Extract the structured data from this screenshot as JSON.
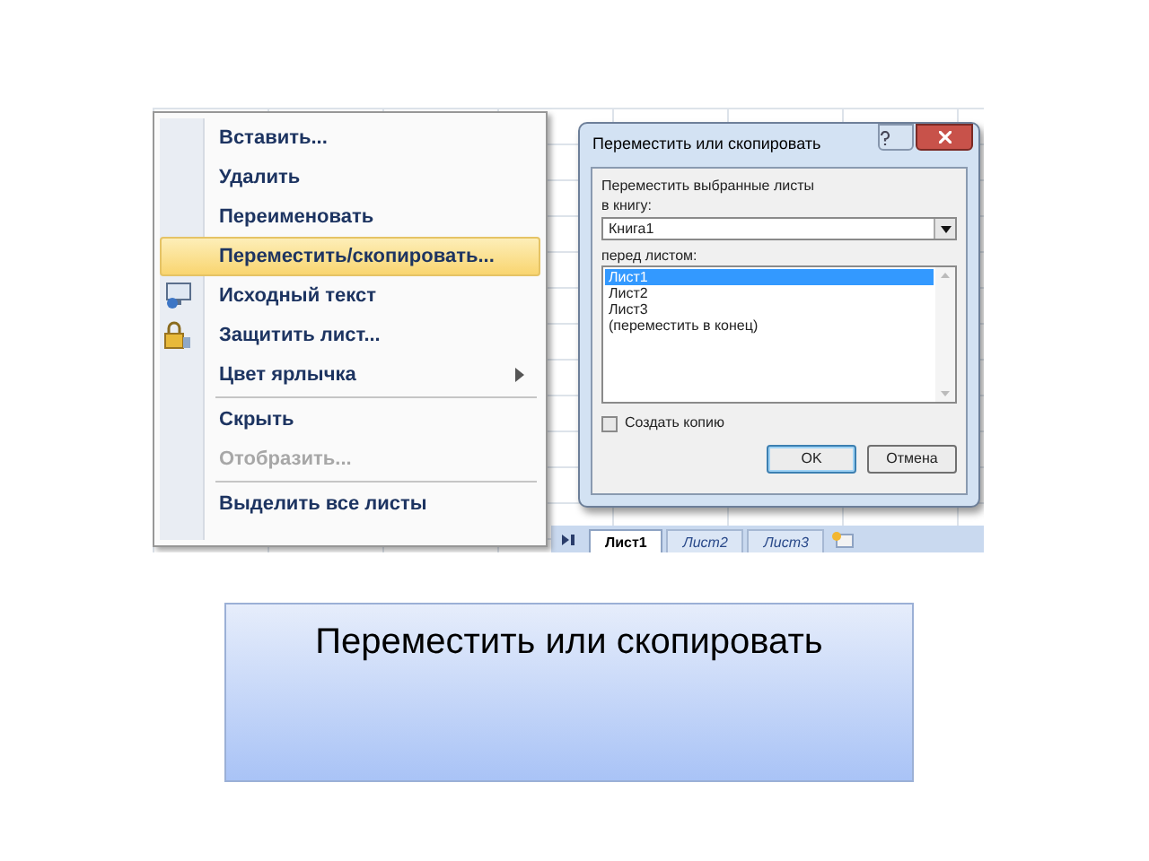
{
  "context_menu": {
    "items": [
      {
        "label": "Вставить...",
        "kind": "normal",
        "separator_before": false
      },
      {
        "label": "Удалить",
        "kind": "normal",
        "separator_before": false
      },
      {
        "label": "Переименовать",
        "kind": "normal",
        "separator_before": false
      },
      {
        "label": "Переместить/скопировать...",
        "kind": "highlighted",
        "separator_before": false
      },
      {
        "label": "Исходный текст",
        "kind": "source",
        "separator_before": false
      },
      {
        "label": "Защитить лист...",
        "kind": "protect",
        "separator_before": false
      },
      {
        "label": "Цвет ярлычка",
        "kind": "submenu",
        "separator_before": false
      },
      {
        "label": "Скрыть",
        "kind": "normal",
        "separator_before": true
      },
      {
        "label": "Отобразить...",
        "kind": "disabled",
        "separator_before": false
      },
      {
        "label": "Выделить все листы",
        "kind": "normal",
        "separator_before": true
      }
    ]
  },
  "dialog": {
    "title": "Переместить или скопировать",
    "prompt": "Переместить выбранные листы",
    "book_label": "в книгу:",
    "book_value": "Книга1",
    "before_label": "перед листом:",
    "sheets": [
      {
        "label": "Лист1",
        "selected": true
      },
      {
        "label": "Лист2",
        "selected": false
      },
      {
        "label": "Лист3",
        "selected": false
      },
      {
        "label": "(переместить в конец)",
        "selected": false
      }
    ],
    "copy_checkbox": {
      "label": "Создать копию",
      "checked": false
    },
    "buttons": [
      {
        "label": "OK",
        "default": true
      },
      {
        "label": "Отмена",
        "default": false
      }
    ]
  },
  "sheet_tabs": [
    {
      "label": "Лист1",
      "selected": true
    },
    {
      "label": "Лист2",
      "selected": false
    },
    {
      "label": "Лист3",
      "selected": false
    }
  ],
  "caption": "Переместить или скопировать"
}
